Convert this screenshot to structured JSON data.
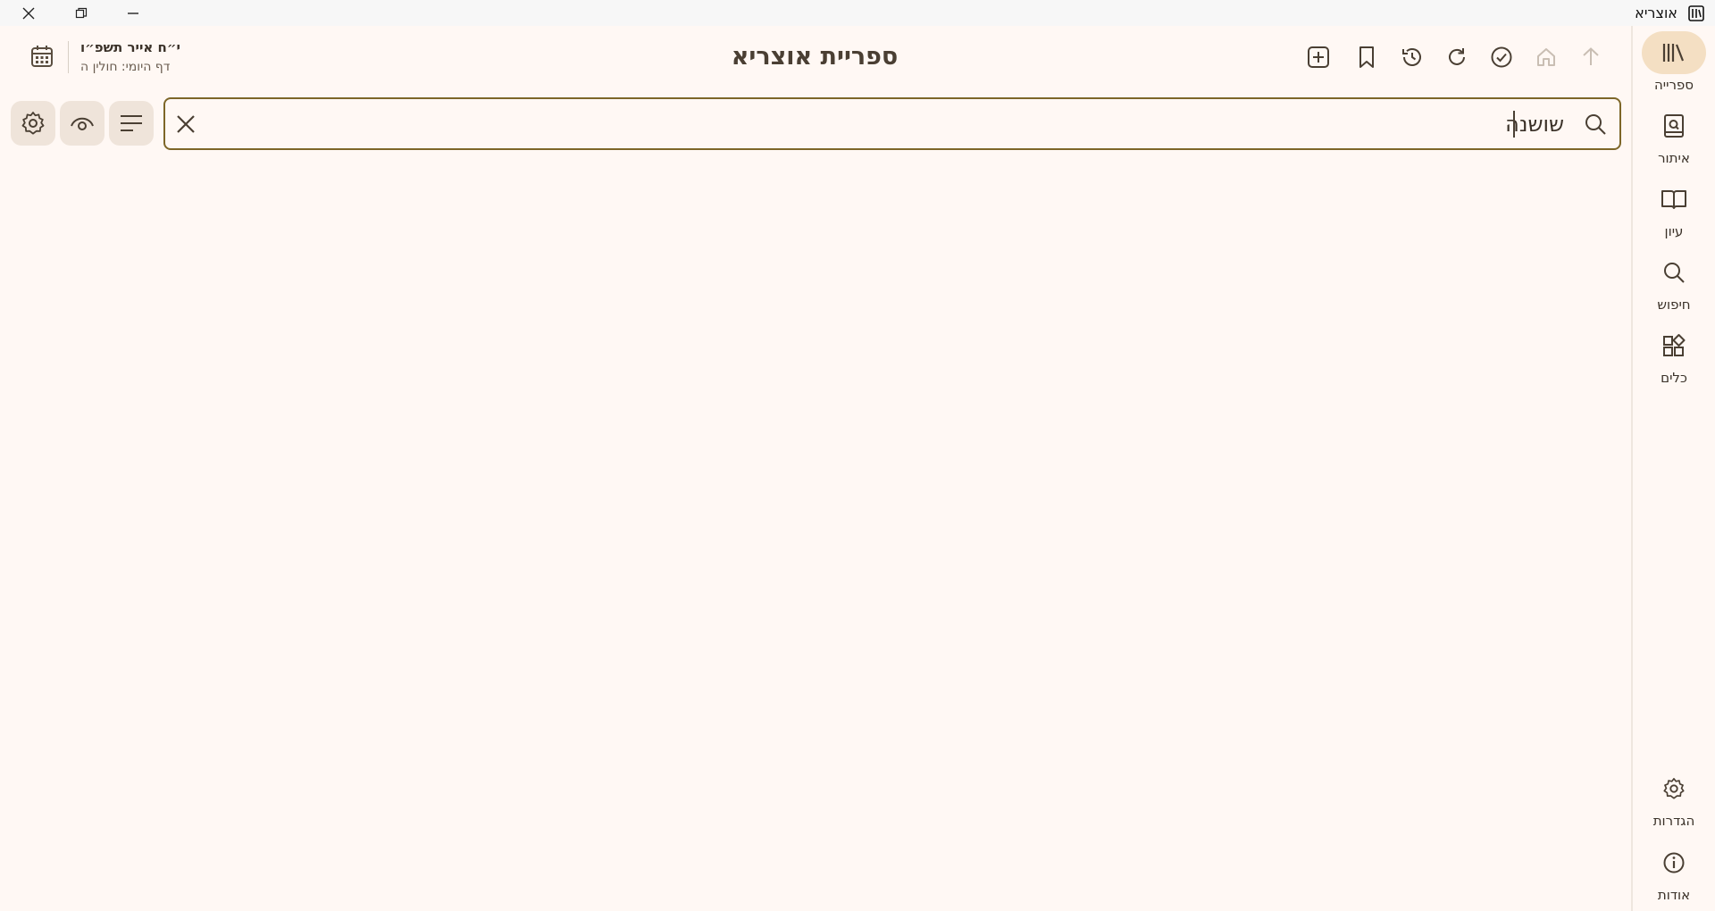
{
  "window": {
    "title": "אוצריא"
  },
  "header": {
    "title": "ספריית אוצריא",
    "hebrew_date": "י״ח אייר תשפ״ו",
    "daf_yomi": "דף היומי: חולין ה"
  },
  "search": {
    "value": "שושנה"
  },
  "nav": {
    "items": [
      {
        "label": "ספרייה",
        "icon": "library-icon",
        "active": true
      },
      {
        "label": "איתור",
        "icon": "find-book-icon",
        "active": false
      },
      {
        "label": "עיון",
        "icon": "open-book-icon",
        "active": false
      },
      {
        "label": "חיפוש",
        "icon": "search-icon",
        "active": false
      },
      {
        "label": "כלים",
        "icon": "tools-icon",
        "active": false
      }
    ],
    "bottom_items": [
      {
        "label": "הגדרות",
        "icon": "settings-icon"
      },
      {
        "label": "אודות",
        "icon": "info-icon"
      }
    ]
  },
  "colors": {
    "background": "#fff8f4",
    "accent_border": "#7d6628",
    "active_nav": "#f4dfc3",
    "button_bg": "#efe4da"
  }
}
